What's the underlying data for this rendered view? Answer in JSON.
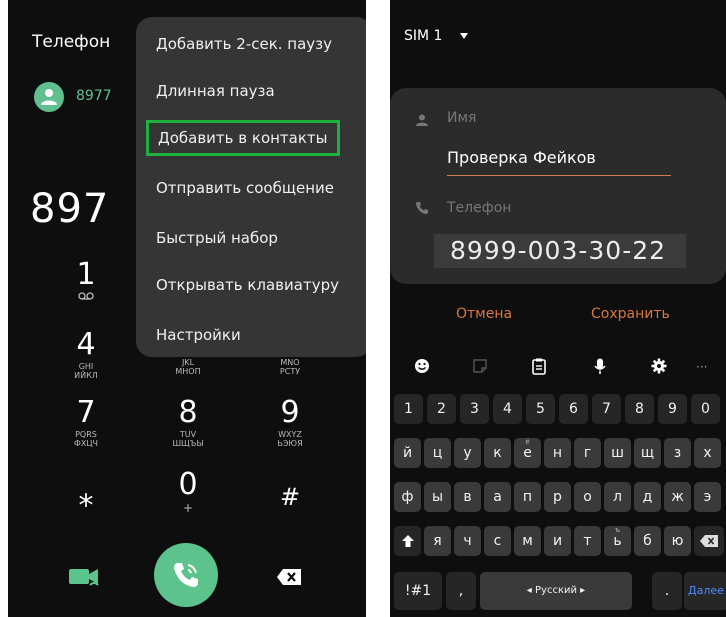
{
  "dialer": {
    "title": "Телефон",
    "recent_number": "8977",
    "dialed_number": "897",
    "keys": [
      {
        "digit": "1",
        "sub": "oo"
      },
      {
        "digit": "4",
        "sub": "GHI\nИЙКЛ"
      },
      {
        "digit": "",
        "sub": "JKL\nМНОП"
      },
      {
        "digit": "",
        "sub": "MNO\nРСТУ"
      },
      {
        "digit": "7",
        "sub": "PQRS\nФХЦЧ"
      },
      {
        "digit": "8",
        "sub": "TUV\nШЩЪЫ"
      },
      {
        "digit": "9",
        "sub": "WXYZ\nЬЭЮЯ"
      },
      {
        "digit": "⁎",
        "sub": ""
      },
      {
        "digit": "0",
        "sub": "+"
      },
      {
        "digit": "#",
        "sub": ""
      }
    ]
  },
  "menu": {
    "items": [
      "Добавить 2-сек. паузу",
      "Длинная пауза",
      "Добавить в контакты",
      "Отправить сообщение",
      "Быстрый набор",
      "Открывать клавиатуру",
      "Настройки"
    ],
    "highlighted_index": 2,
    "highlight_color": "#1fb13d"
  },
  "contact": {
    "sim": "SIM 1",
    "name_label": "Имя",
    "name_value": "Проверка Фейков",
    "phone_label": "Телефон",
    "phone_value": "8999-003-30-22",
    "cancel": "Отмена",
    "save": "Сохранить",
    "accent": "#d9773d"
  },
  "keyboard": {
    "row_numbers": [
      "1",
      "2",
      "3",
      "4",
      "5",
      "6",
      "7",
      "8",
      "9",
      "0"
    ],
    "row1": [
      "й",
      "ц",
      "у",
      "к",
      "е",
      "н",
      "г",
      "ш",
      "щ",
      "з",
      "х"
    ],
    "row1_sup": [
      "",
      "",
      "",
      "",
      "ё",
      "",
      "",
      "",
      "",
      "",
      ""
    ],
    "row2": [
      "ф",
      "ы",
      "в",
      "а",
      "п",
      "р",
      "о",
      "л",
      "д",
      "ж",
      "э"
    ],
    "row3": [
      "я",
      "ч",
      "с",
      "м",
      "и",
      "т",
      "ь",
      "б",
      "ю"
    ],
    "row3_sup": [
      "",
      "",
      "",
      "",
      "",
      "",
      "ъ",
      "",
      ""
    ],
    "symbols": "!#1",
    "comma": ",",
    "space": "◂ Русский ▸",
    "period": ".",
    "next": "Далее"
  }
}
